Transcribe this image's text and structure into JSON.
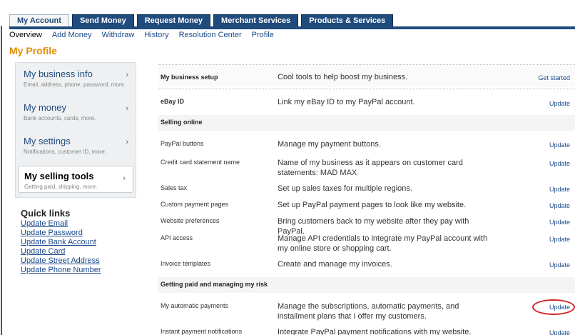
{
  "tabs": [
    "My Account",
    "Send Money",
    "Request Money",
    "Merchant Services",
    "Products & Services"
  ],
  "subnav": [
    "Overview",
    "Add Money",
    "Withdraw",
    "History",
    "Resolution Center",
    "Profile"
  ],
  "page_title": "My Profile",
  "sidebar": [
    {
      "title": "My business info",
      "sub": "Email, address, phone, password, more."
    },
    {
      "title": "My money",
      "sub": "Bank accounts, cards, more."
    },
    {
      "title": "My settings",
      "sub": "Notifications, customer ID, more."
    },
    {
      "title": "My selling tools",
      "sub": "Getting paid, shipping, more."
    }
  ],
  "sidebar_arrow": "›",
  "quick_links": {
    "title": "Quick links",
    "items": [
      "Update Email",
      "Update Password",
      "Update Bank Account",
      "Update Card",
      "Update Street Address",
      "Update Phone Number"
    ]
  },
  "business_setup": {
    "name": "My business setup",
    "desc": "Cool tools to help boost my business.",
    "action": "Get started"
  },
  "ebay": {
    "name": "eBay ID",
    "desc": "Link my eBay ID to my PayPal account.",
    "action": "Update"
  },
  "section_selling": "Selling online",
  "selling_rows": [
    {
      "name": "PayPal buttons",
      "desc": "Manage my payment buttons.",
      "action": "Update"
    },
    {
      "name": "Credit card statement name",
      "desc": "Name of my business as it appears on customer card statements: MAD MAX",
      "action": "Update"
    },
    {
      "name": "Sales tax",
      "desc": "Set up sales taxes for multiple regions.",
      "action": "Update"
    },
    {
      "name": "Custom payment pages",
      "desc": "Set up PayPal payment pages to look like my website.",
      "action": "Update"
    },
    {
      "name": "Website preferences",
      "desc": "Bring customers back to my website after they pay with PayPal.",
      "action": "Update"
    },
    {
      "name": "API access",
      "desc": "Manage API credentials to integrate my PayPal account with my online store or shopping cart.",
      "action": "Update"
    },
    {
      "name": "Invoice templates",
      "desc": "Create and manage my invoices.",
      "action": "Update"
    }
  ],
  "section_risk": "Getting paid and managing my risk",
  "risk_rows": [
    {
      "name": "My automatic payments",
      "desc": "Manage the subscriptions, automatic payments, and installment plans that I offer my customers.",
      "action": "Update"
    },
    {
      "name": "Instant payment notifications",
      "desc": "Integrate PayPal payment notifications with my website.",
      "action": "Update"
    }
  ],
  "colors": {
    "brand": "#1f4b7d",
    "title": "#e08c00",
    "highlight": "#d42020"
  }
}
